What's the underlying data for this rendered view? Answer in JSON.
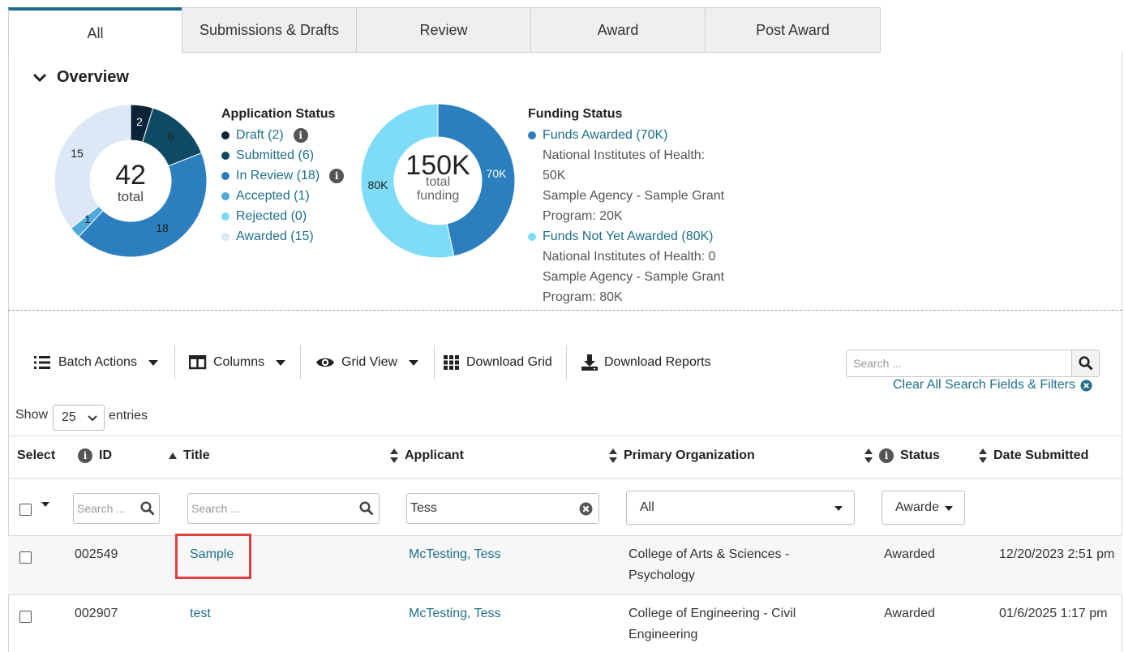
{
  "tabs": [
    {
      "label": "All",
      "active": true
    },
    {
      "label": "Submissions & Drafts"
    },
    {
      "label": "Review"
    },
    {
      "label": "Award"
    },
    {
      "label": "Post Award"
    }
  ],
  "overview": {
    "title": "Overview",
    "application_status": {
      "title": "Application Status",
      "total": "42",
      "total_label": "total",
      "items": [
        {
          "label": "Draft (2)",
          "value": 2,
          "color": "#0b2438",
          "info": true
        },
        {
          "label": "Submitted (6)",
          "value": 6,
          "color": "#0e4a64",
          "info": false
        },
        {
          "label": "In Review (18)",
          "value": 18,
          "color": "#2b7fbf",
          "info": true
        },
        {
          "label": "Accepted (1)",
          "value": 1,
          "color": "#4fa9d9",
          "info": false
        },
        {
          "label": "Rejected (0)",
          "value": 0,
          "color": "#7fd9f5",
          "info": false
        },
        {
          "label": "Awarded (15)",
          "value": 15,
          "color": "#dce8f5",
          "info": false
        }
      ],
      "slice_labels": [
        "2",
        "6",
        "18",
        "1",
        "15"
      ]
    },
    "funding_status": {
      "title": "Funding Status",
      "total": "150K",
      "total_label_1": "total",
      "total_label_2": "funding",
      "awarded": {
        "label": "Funds Awarded (70K)",
        "value": 70,
        "color": "#2b7fbf",
        "slice_label": "70K"
      },
      "awarded_details": [
        "National Institutes of Health:",
        "50K",
        "Sample Agency - Sample Grant",
        "Program: 20K"
      ],
      "not_awarded": {
        "label": "Funds Not Yet Awarded (80K)",
        "value": 80,
        "color": "#7fdcf8",
        "slice_label": "80K"
      },
      "not_awarded_details": [
        "National Institutes of Health: 0",
        "Sample Agency - Sample Grant",
        "Program: 80K"
      ]
    }
  },
  "toolbar": {
    "batch_actions": "Batch Actions",
    "columns": "Columns",
    "grid_view": "Grid View",
    "download_grid": "Download Grid",
    "download_reports": "Download Reports",
    "search_placeholder": "Search ...",
    "clear_all": "Clear All Search Fields & Filters"
  },
  "length": {
    "show": "Show",
    "value": "25",
    "entries": "entries"
  },
  "table": {
    "headers": {
      "select": "Select",
      "id": "ID",
      "title": "Title",
      "applicant": "Applicant",
      "org": "Primary Organization",
      "status": "Status",
      "date": "Date Submitted"
    },
    "filters": {
      "id_placeholder": "Search ...",
      "title_placeholder": "Search ...",
      "applicant_value": "Tess",
      "org_value": "All",
      "status_value": "Awarde"
    },
    "rows": [
      {
        "id": "002549",
        "title": "Sample",
        "applicant": "McTesting, Tess",
        "org_line1": "College of Arts & Sciences -",
        "org_line2": "Psychology",
        "status": "Awarded",
        "date": "12/20/2023 2:51 pm"
      },
      {
        "id": "002907",
        "title": "test",
        "applicant": "McTesting, Tess",
        "org_line1": "College of Engineering - Civil",
        "org_line2": "Engineering",
        "status": "Awarded",
        "date": "01/6/2025 1:17 pm"
      }
    ]
  }
}
